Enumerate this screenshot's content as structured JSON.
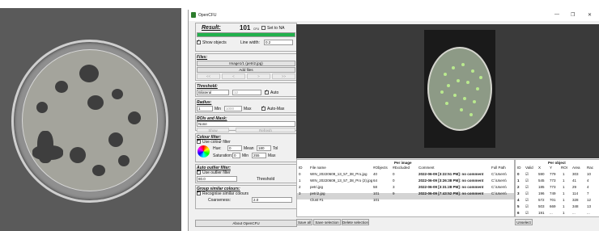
{
  "window": {
    "title": "OpenCFU",
    "minimize": "—",
    "restore": "❐",
    "close": "✕"
  },
  "result": {
    "label": "Result:",
    "value": "101",
    "unit": "CFU",
    "set_na_label": "Set to NA"
  },
  "show_objects": {
    "label": "Show objects",
    "line_width_label": "Line width:",
    "line_width_value": "0.2"
  },
  "files": {
    "header": "Files:",
    "current": "Image1/1 (petri2.jpg)",
    "add_files": "Add files",
    "nav": [
      "<<",
      "<",
      ">",
      ">>"
    ]
  },
  "threshold": {
    "header": "Threshold:",
    "mode": "Bilateral",
    "value": "12",
    "auto_label": "Auto"
  },
  "radius": {
    "header": "Radius:",
    "min_value": "1",
    "min_label": "Min",
    "max_value": "1000",
    "max_label": "Max",
    "auto_max_label": "Auto-Max"
  },
  "roi": {
    "header": "ROIs and Mask:",
    "value": "None",
    "show": "Show",
    "refresh": "Refresh"
  },
  "colour_filter": {
    "header": "Colour filter:",
    "use_label": "Use colour filter",
    "hue_label": "Hue:",
    "hue_value": "0",
    "mean_label": "Mean",
    "mean_value": "180",
    "tol_label": "Tol",
    "saturation_label": "Saturation:",
    "sat_min": "0",
    "sat_min_label": "Min",
    "sat_max": "255",
    "sat_max_label": "Max"
  },
  "outlier_filter": {
    "header": "Auto outlier filter:",
    "use_label": "Use outlier filter",
    "value": "80.0",
    "threshold_label": "Threshold"
  },
  "group_colours": {
    "header": "Group similar colours:",
    "recognise_label": "Recognise similar colours",
    "coarseness_label": "Coarseness:",
    "coarseness_value": "2.0"
  },
  "about_button": "About OpenCFU",
  "per_image": {
    "title": "Per image",
    "columns": [
      "ID",
      "File name",
      "#Objects",
      "#Excluded",
      "Comment",
      "Full Path"
    ],
    "rows": [
      [
        "0",
        "WIN_20220609_13_57_38_Pro.jpg",
        "40",
        "0",
        "2022-06-09 [3:22:51 PM]: no comment",
        "C:\\Users\\"
      ],
      [
        "1",
        "WIN_20220609_13_57_38_Pro (2).jpg",
        "64",
        "0",
        "2022-06-09 [3:26:38 PM]: no comment",
        "C:\\Users\\"
      ],
      [
        "2",
        "petri.jpg",
        "58",
        "3",
        "2022-06-09 [3:31:28 PM]: no comment",
        "C:\\Users\\"
      ],
      [
        "3",
        "petri2.jpg",
        "101",
        "9",
        "2022-06-09 [7:43:52 PM]: no comment",
        "C:\\Users\\"
      ],
      [
        "",
        "Clust #1",
        "101",
        "",
        "",
        ""
      ]
    ],
    "save_all": "Save all",
    "save_selection": "Save selection",
    "delete_selection": "Delete selection"
  },
  "per_object": {
    "title": "Per object",
    "columns": [
      "ID",
      "Valid",
      "X",
      "Y",
      "ROI",
      "Area",
      "Rac"
    ],
    "rows": [
      [
        "0",
        "☑",
        "590",
        "779",
        "1",
        "303",
        "10"
      ],
      [
        "1",
        "☑",
        "545",
        "773",
        "1",
        "41",
        "4"
      ],
      [
        "2",
        "☑",
        "185",
        "773",
        "1",
        "29",
        "4"
      ],
      [
        "3",
        "☑",
        "196",
        "749",
        "1",
        "114",
        "7"
      ],
      [
        "4",
        "☑",
        "572",
        "701",
        "1",
        "328",
        "12"
      ],
      [
        "5",
        "☑",
        "503",
        "669",
        "1",
        "348",
        "13"
      ],
      [
        "6",
        "☑",
        "191",
        "...",
        "1",
        "...",
        "..."
      ]
    ],
    "unselect": "Unselect"
  },
  "colors": {
    "progress_green": "#22b14c",
    "selected_row": "#d4d4d4",
    "colony_green": "#b9e98e"
  },
  "icons": {
    "app": "opencfu-app-icon",
    "colour_wheel": "colour-wheel-icon"
  }
}
